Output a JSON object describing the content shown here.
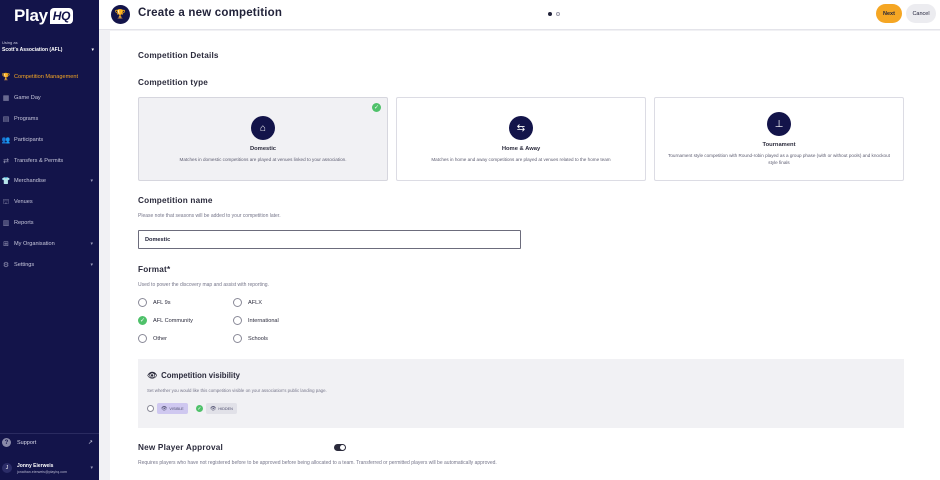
{
  "sidebar": {
    "logo_text": "Play",
    "logo_badge": "HQ",
    "using_as": "Using as",
    "association": "Scott's Association (AFL)",
    "items": [
      {
        "label": "Competition Management",
        "icon": "trophy-icon",
        "active": true,
        "has_caret": false
      },
      {
        "label": "Game Day",
        "icon": "calendar-icon",
        "active": false,
        "has_caret": false
      },
      {
        "label": "Programs",
        "icon": "book-icon",
        "active": false,
        "has_caret": false
      },
      {
        "label": "Participants",
        "icon": "people-icon",
        "active": false,
        "has_caret": false
      },
      {
        "label": "Transfers & Permits",
        "icon": "transfer-icon",
        "active": false,
        "has_caret": false
      },
      {
        "label": "Merchandise",
        "icon": "shirt-icon",
        "active": false,
        "has_caret": true
      },
      {
        "label": "Venues",
        "icon": "venue-icon",
        "active": false,
        "has_caret": false
      },
      {
        "label": "Reports",
        "icon": "chart-icon",
        "active": false,
        "has_caret": false
      },
      {
        "label": "My Organisation",
        "icon": "org-icon",
        "active": false,
        "has_caret": true
      },
      {
        "label": "Settings",
        "icon": "gear-icon",
        "active": false,
        "has_caret": true
      }
    ],
    "support": "Support",
    "user": {
      "initial": "J",
      "name": "Jonny Eierweis",
      "email": "jonathan.eierweis@playhq.com"
    }
  },
  "header": {
    "title": "Create a new competition",
    "next_label": "Next",
    "cancel_label": "Cancel",
    "step": 1,
    "steps": 2
  },
  "form": {
    "section_title": "Competition Details",
    "type_label": "Competition type",
    "types": [
      {
        "title": "Domestic",
        "desc": "Matches in domestic competitions are played at venues linked to your association.",
        "selected": true
      },
      {
        "title": "Home & Away",
        "desc": "Matches in home and away competitions are played at venues related to the home team",
        "selected": false
      },
      {
        "title": "Tournament",
        "desc": "Tournament style competition with Round-robin played as a group phase (with or without pools) and knockout style finals",
        "selected": false
      }
    ],
    "name_label": "Competition name",
    "name_hint": "Please note that seasons will be added to your competition later.",
    "name_value": "Domestic",
    "format_label": "Format*",
    "format_hint": "Used to power the discovery map and assist with reporting.",
    "formats": [
      {
        "label": "AFL 9s",
        "selected": false
      },
      {
        "label": "AFLX",
        "selected": false
      },
      {
        "label": "AFL Community",
        "selected": true
      },
      {
        "label": "International",
        "selected": false
      },
      {
        "label": "Other",
        "selected": false
      },
      {
        "label": "Schools",
        "selected": false
      }
    ],
    "visibility": {
      "title": "Competition visibility",
      "hint": "Set whether you would like this competition visible on your association's public landing page.",
      "visible_label": "VISIBLE",
      "hidden_label": "HIDDEN",
      "selected": "hidden"
    },
    "approval": {
      "title": "New Player Approval",
      "hint": "Requires players who have not registered before to be approved before being allocated to a team. Transferred or permitted players will be automatically approved.",
      "enabled": true
    }
  },
  "colors": {
    "sidebar": "#13144a",
    "accent": "#f5a623",
    "check": "#4fc16a"
  }
}
